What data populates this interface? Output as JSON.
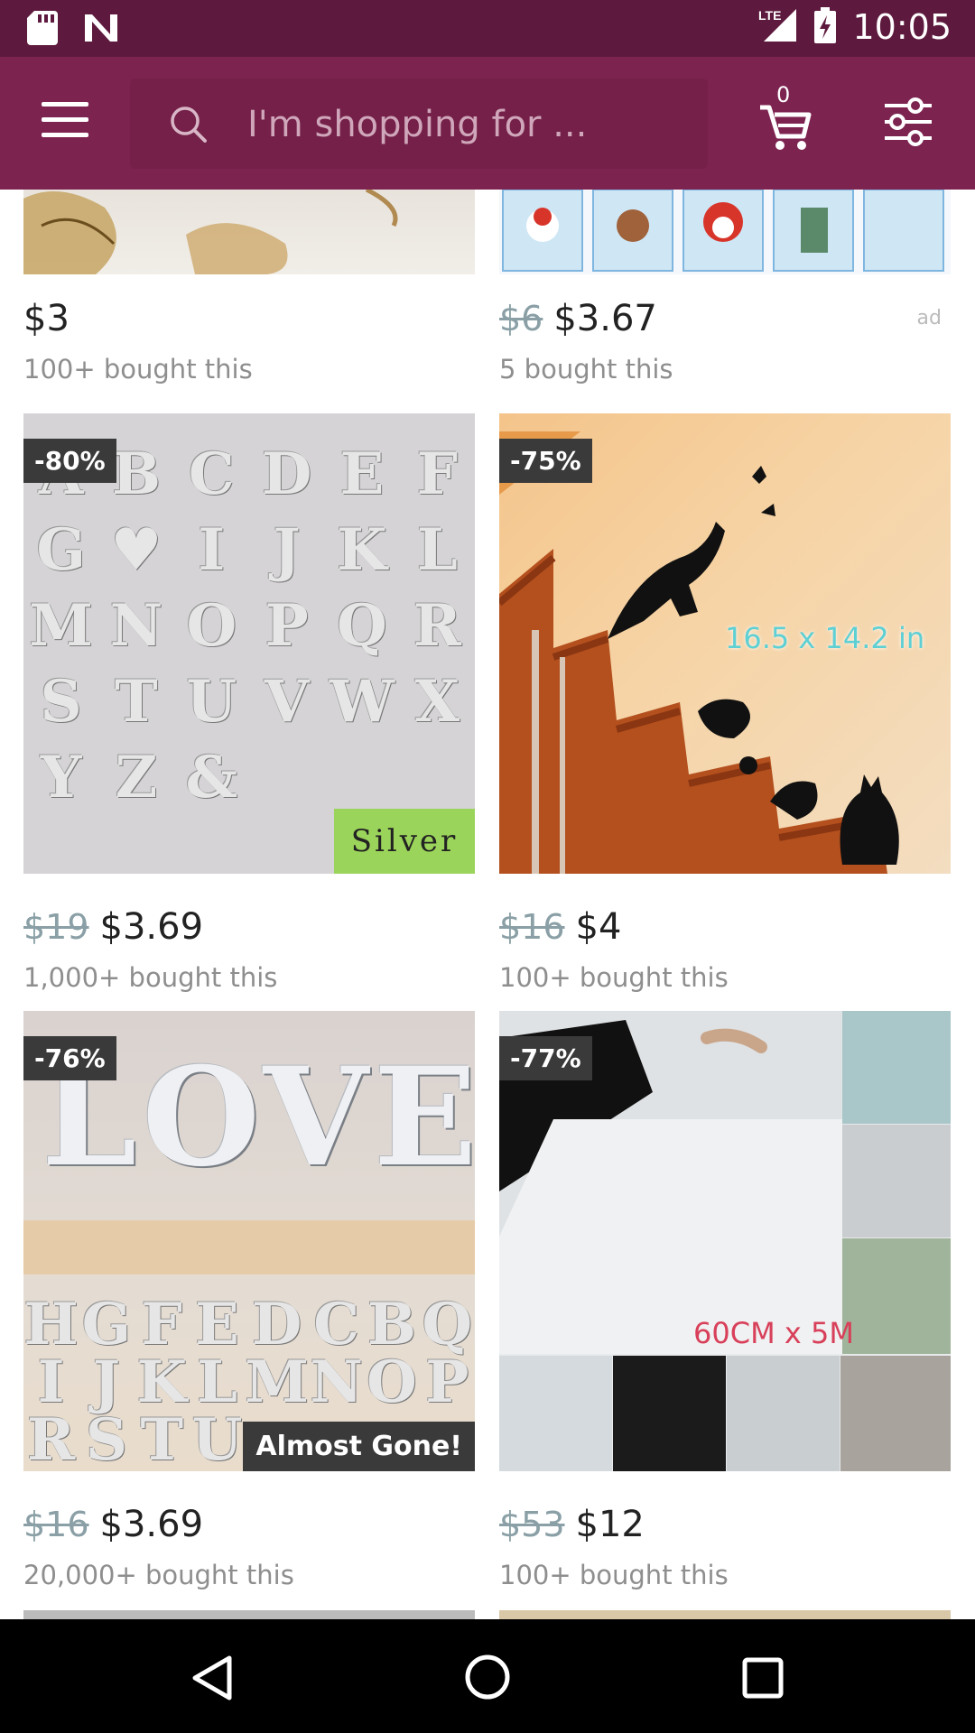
{
  "status_bar": {
    "time": "10:05",
    "network": "LTE"
  },
  "search": {
    "placeholder": "I'm shopping for ..."
  },
  "cart": {
    "count": "0"
  },
  "products": [
    {
      "old_price": "",
      "price": "$3",
      "bought": "100+ bought this",
      "badge": "",
      "ad": ""
    },
    {
      "old_price": "$6",
      "price": "$3.67",
      "bought": "5 bought this",
      "badge": "",
      "ad": "ad"
    },
    {
      "old_price": "$19",
      "price": "$3.69",
      "bought": "1,000+ bought this",
      "badge": "-80%",
      "tag": "Silver",
      "letters": [
        "A",
        "B",
        "C",
        "D",
        "E",
        "F",
        "G",
        "♥",
        "I",
        "J",
        "K",
        "L",
        "M",
        "N",
        "O",
        "P",
        "Q",
        "R",
        "S",
        "T",
        "U",
        "V",
        "W",
        "X",
        "Y",
        "Z",
        "&"
      ]
    },
    {
      "old_price": "$16",
      "price": "$4",
      "bought": "100+ bought this",
      "badge": "-75%",
      "size_text": "16.5 x 14.2 in"
    },
    {
      "old_price": "$16",
      "price": "$3.69",
      "bought": "20,000+ bought this",
      "badge": "-76%",
      "tag": "Almost Gone!",
      "word": "LOVE",
      "letters": [
        "H",
        "G",
        "F",
        "E",
        "D",
        "C",
        "B",
        "Q",
        "I",
        "J",
        "K",
        "L",
        "M",
        "N",
        "O",
        "P",
        "R",
        "S",
        "T",
        "U"
      ]
    },
    {
      "old_price": "$53",
      "price": "$12",
      "bought": "100+ bought this",
      "badge": "-77%",
      "size_text": "60CM x 5M"
    }
  ],
  "colors": {
    "status_bar": "#5e1a3e",
    "app_bar": "#7d2350",
    "search_box": "#742048",
    "badge": "#3a3a3a",
    "silver_tag": "#9bd45a"
  },
  "icons": [
    "sd-card-icon",
    "n-notification-icon",
    "lte-signal-icon",
    "battery-icon",
    "menu-icon",
    "search-icon",
    "cart-icon",
    "filter-icon",
    "back-icon",
    "home-icon",
    "recents-icon"
  ]
}
